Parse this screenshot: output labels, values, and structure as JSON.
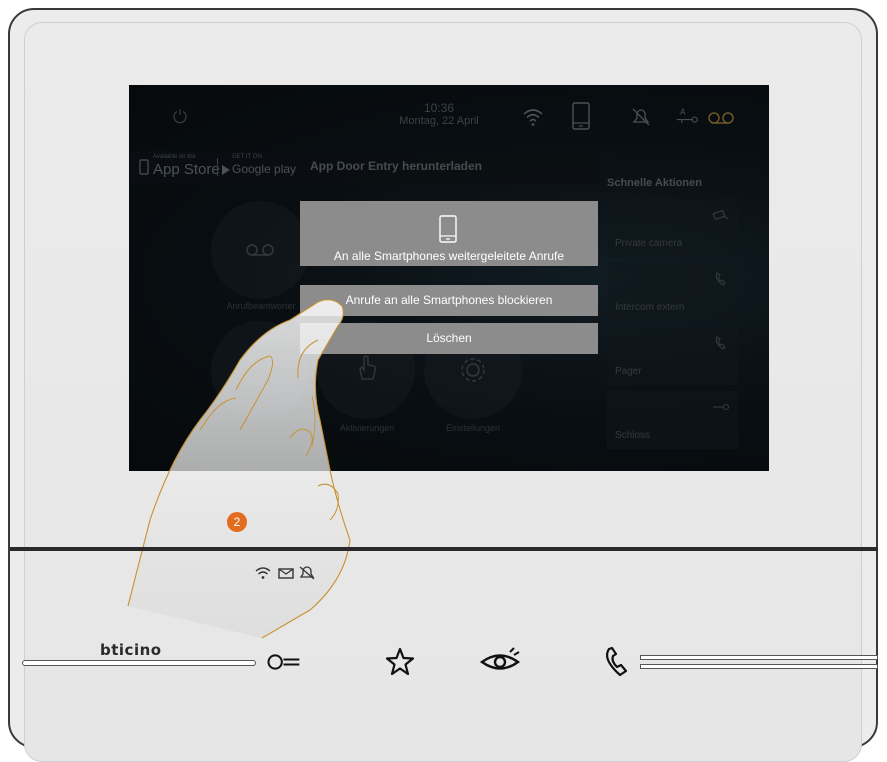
{
  "status": {
    "time": "10:36",
    "date": "Montag, 22 April"
  },
  "banner": {
    "app_store_small": "Available on the",
    "app_store": "App Store",
    "google_small": "GET IT ON",
    "google_play": "Google play",
    "text": "App Door Entry herunterladen"
  },
  "quick_actions": {
    "title": "Schnelle Aktionen",
    "items": [
      {
        "label": "Private camera",
        "icon": "camera-icon"
      },
      {
        "label": "Intercom extern",
        "icon": "phone-icon"
      },
      {
        "label": "Pager",
        "icon": "phone-icon"
      },
      {
        "label": "Schloss",
        "icon": "key-icon"
      }
    ]
  },
  "home": {
    "answering_machine": "Anrufbeantworter",
    "activations": "Aktivierungen",
    "settings": "Einstellungen"
  },
  "popup": {
    "message": "An alle Smartphones weitergeleitete Anrufe",
    "block_button": "Anrufe an alle Smartphones blockieren",
    "delete_button": "Löschen"
  },
  "step_badge": "2",
  "brand": "bticino",
  "colors": {
    "accent": "#e36d1f",
    "popup": "#8c8c8c",
    "screen_bg": "#111b22"
  }
}
